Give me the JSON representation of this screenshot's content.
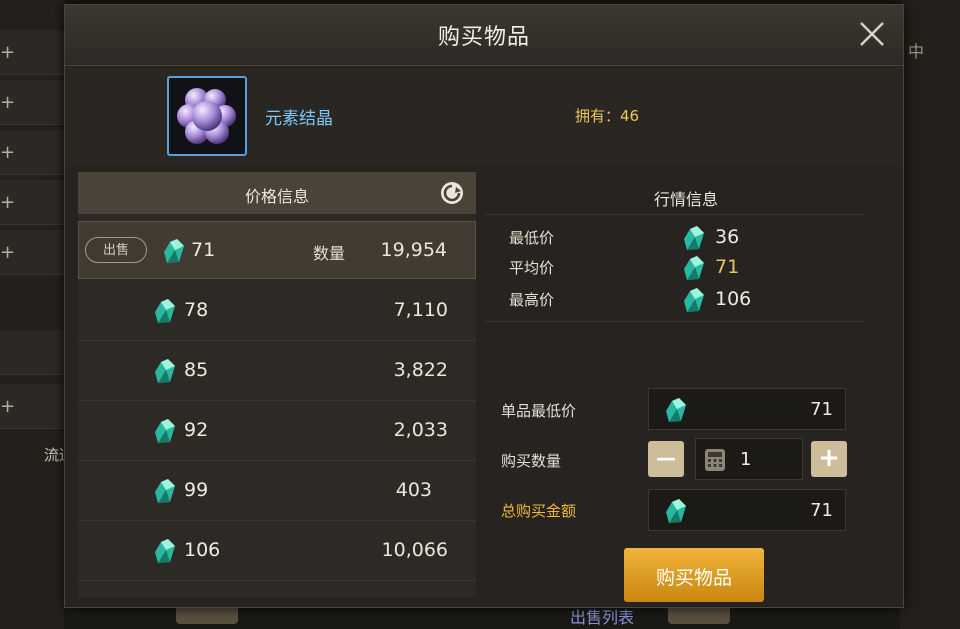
{
  "background": {
    "left_label": "流通",
    "right_label": "中",
    "bottom_label": "出售列表"
  },
  "modal": {
    "title": "购买物品"
  },
  "item": {
    "name": "元素结晶",
    "owned_label": "拥有：",
    "owned_count": "46"
  },
  "price_info": {
    "header": "价格信息",
    "sell_tag": "出售",
    "qty_label": "数量",
    "rows": [
      {
        "price": "71",
        "qty": "19,954"
      },
      {
        "price": "78",
        "qty": "7,110"
      },
      {
        "price": "85",
        "qty": "3,822"
      },
      {
        "price": "92",
        "qty": "2,033"
      },
      {
        "price": "99",
        "qty": "403"
      },
      {
        "price": "106",
        "qty": "10,066"
      }
    ]
  },
  "market": {
    "header": "行情信息",
    "min_label": "最低价",
    "min_value": "36",
    "avg_label": "平均价",
    "avg_value": "71",
    "max_label": "最高价",
    "max_value": "106"
  },
  "purchase": {
    "unit_price_label": "单品最低价",
    "unit_price_value": "71",
    "qty_label": "购买数量",
    "qty_value": "1",
    "minus": "—",
    "plus": "+",
    "total_label": "总购买金额",
    "total_value": "71",
    "buy_button": "购买物品"
  },
  "colors": {
    "item_name": "#79c8ff",
    "gold": "#e8c75a",
    "buy_button": "#e0a12a"
  }
}
